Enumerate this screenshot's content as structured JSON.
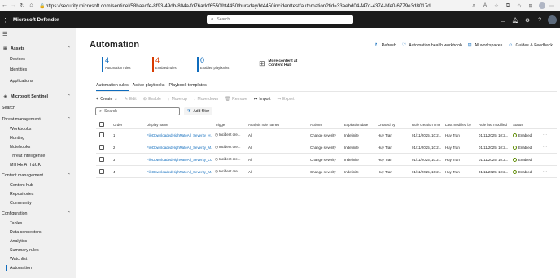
{
  "browser": {
    "url": "https://security.microsoft.com/sentinel/58baedfe-8f93-49db-804a-fd76adcf6550/ht4450thursday/ht4450incidenttest/automation?tid=33aebd04-f47d-4374-bfe0-6779e3d8017d",
    "back_icon": "back-arrow",
    "forward_icon": "forward-arrow",
    "reload_icon": "reload",
    "home_icon": "home",
    "right_icons": [
      "zoom-icon",
      "read-aloud-icon",
      "favorite-icon",
      "extensions-icon",
      "favorites-bar-icon",
      "collections-icon",
      "profile-avatar",
      "more-icon"
    ]
  },
  "topbar": {
    "app_name": "Microsoft Defender",
    "search_placeholder": "Search",
    "icons": [
      "devices-icon",
      "bell-icon",
      "gear-icon",
      "help-icon",
      "user-avatar"
    ]
  },
  "sidebar": {
    "sections": [
      {
        "label": "Assets",
        "icon": "assets-icon",
        "bold": true,
        "chevron": "up",
        "items": [
          "Devices",
          "Identities",
          "Applications"
        ]
      },
      {
        "label": "Microsoft Sentinel",
        "icon": "sentinel-icon",
        "bold": true,
        "chevron": "up",
        "items": [
          "Search"
        ]
      },
      {
        "label": "Threat management",
        "chevron": "up",
        "items": [
          "Workbooks",
          "Hunting",
          "Notebooks",
          "Threat intelligence",
          "MITRE ATT&CK"
        ]
      },
      {
        "label": "Content management",
        "chevron": "up",
        "items": [
          "Content hub",
          "Repositories",
          "Community"
        ]
      },
      {
        "label": "Configuration",
        "chevron": "up",
        "items": [
          "Tables",
          "Data connectors",
          "Analytics",
          "Summary rules",
          "Watchlist",
          "Automation"
        ]
      }
    ],
    "active_item": "Automation"
  },
  "page": {
    "title": "Automation",
    "actions": [
      {
        "label": "Refresh",
        "icon": "refresh-icon"
      },
      {
        "label": "Automation health workbook",
        "icon": "heart-icon"
      },
      {
        "label": "All workspaces",
        "icon": "workspaces-icon"
      },
      {
        "label": "Guides & Feedback",
        "icon": "feedback-icon"
      }
    ],
    "stats": [
      {
        "value": "4",
        "caption": "Automation rules",
        "color": "#0f6cbd"
      },
      {
        "value": "4",
        "caption": "Enabled rules",
        "color": "#d83b01"
      },
      {
        "value": "0",
        "caption": "Enabled playbooks",
        "color": "#0f6cbd"
      }
    ],
    "more_content": {
      "line1": "More content at",
      "line2": "Content Hub",
      "icon": "content-hub-icon"
    },
    "tabs": [
      "Automation rules",
      "Active playbooks",
      "Playbook templates"
    ],
    "selected_tab": "Automation rules",
    "toolbar": [
      {
        "label": "Create",
        "icon": "plus-icon",
        "disabled": false,
        "caret": true
      },
      {
        "label": "Edit",
        "icon": "edit-icon",
        "disabled": true
      },
      {
        "label": "Enable",
        "icon": "enable-icon",
        "disabled": true
      },
      {
        "label": "Move up",
        "icon": "up-arrow-icon",
        "disabled": true
      },
      {
        "label": "Move down",
        "icon": "down-arrow-icon",
        "disabled": true
      },
      {
        "label": "Remove",
        "icon": "trash-icon",
        "disabled": true
      },
      {
        "label": "Import",
        "icon": "import-icon",
        "disabled": false
      },
      {
        "label": "Export",
        "icon": "export-icon",
        "disabled": true
      }
    ],
    "search_placeholder": "Search",
    "add_filter_label": "Add filter",
    "table": {
      "columns": [
        "Order",
        "Display name",
        "Trigger",
        "Analytic rule names",
        "Actions",
        "Expiration date",
        "Created by",
        "Rule creation time",
        "Last modified by",
        "Rule last modified",
        "Status"
      ],
      "rows": [
        {
          "order": "1",
          "name": "FileDownloadedHighRateAll_Severity_H...",
          "trigger": "Incident cre...",
          "analytic": "All",
          "actions": "Change severity",
          "expiration": "Indefinite",
          "created_by": "Huy Tran",
          "creation_time": "01/11/2025, 10:2...",
          "modified_by": "Huy Tran",
          "last_modified": "01/11/2025, 10:2...",
          "status": "Enabled"
        },
        {
          "order": "2",
          "name": "FileDownloadedHighRateAll_Severity_M...",
          "trigger": "Incident cre...",
          "analytic": "All",
          "actions": "Change severity",
          "expiration": "Indefinite",
          "created_by": "Huy Tran",
          "creation_time": "01/11/2025, 10:2...",
          "modified_by": "Huy Tran",
          "last_modified": "01/11/2025, 10:2...",
          "status": "Enabled"
        },
        {
          "order": "3",
          "name": "FileDownloadedHighRateAll_Severity_LO...",
          "trigger": "Incident cre...",
          "analytic": "All",
          "actions": "Change severity",
          "expiration": "Indefinite",
          "created_by": "Huy Tran",
          "creation_time": "01/11/2025, 10:2...",
          "modified_by": "Huy Tran",
          "last_modified": "01/11/2025, 10:2...",
          "status": "Enabled"
        },
        {
          "order": "4",
          "name": "FileDownloadedHighRateAll_Severity_M...",
          "trigger": "Incident cre...",
          "analytic": "All",
          "actions": "Change severity",
          "expiration": "Indefinite",
          "created_by": "Huy Tran",
          "creation_time": "01/11/2025, 10:2...",
          "modified_by": "Huy Tran",
          "last_modified": "01/11/2025, 10:2...",
          "status": "Enabled"
        }
      ]
    }
  }
}
